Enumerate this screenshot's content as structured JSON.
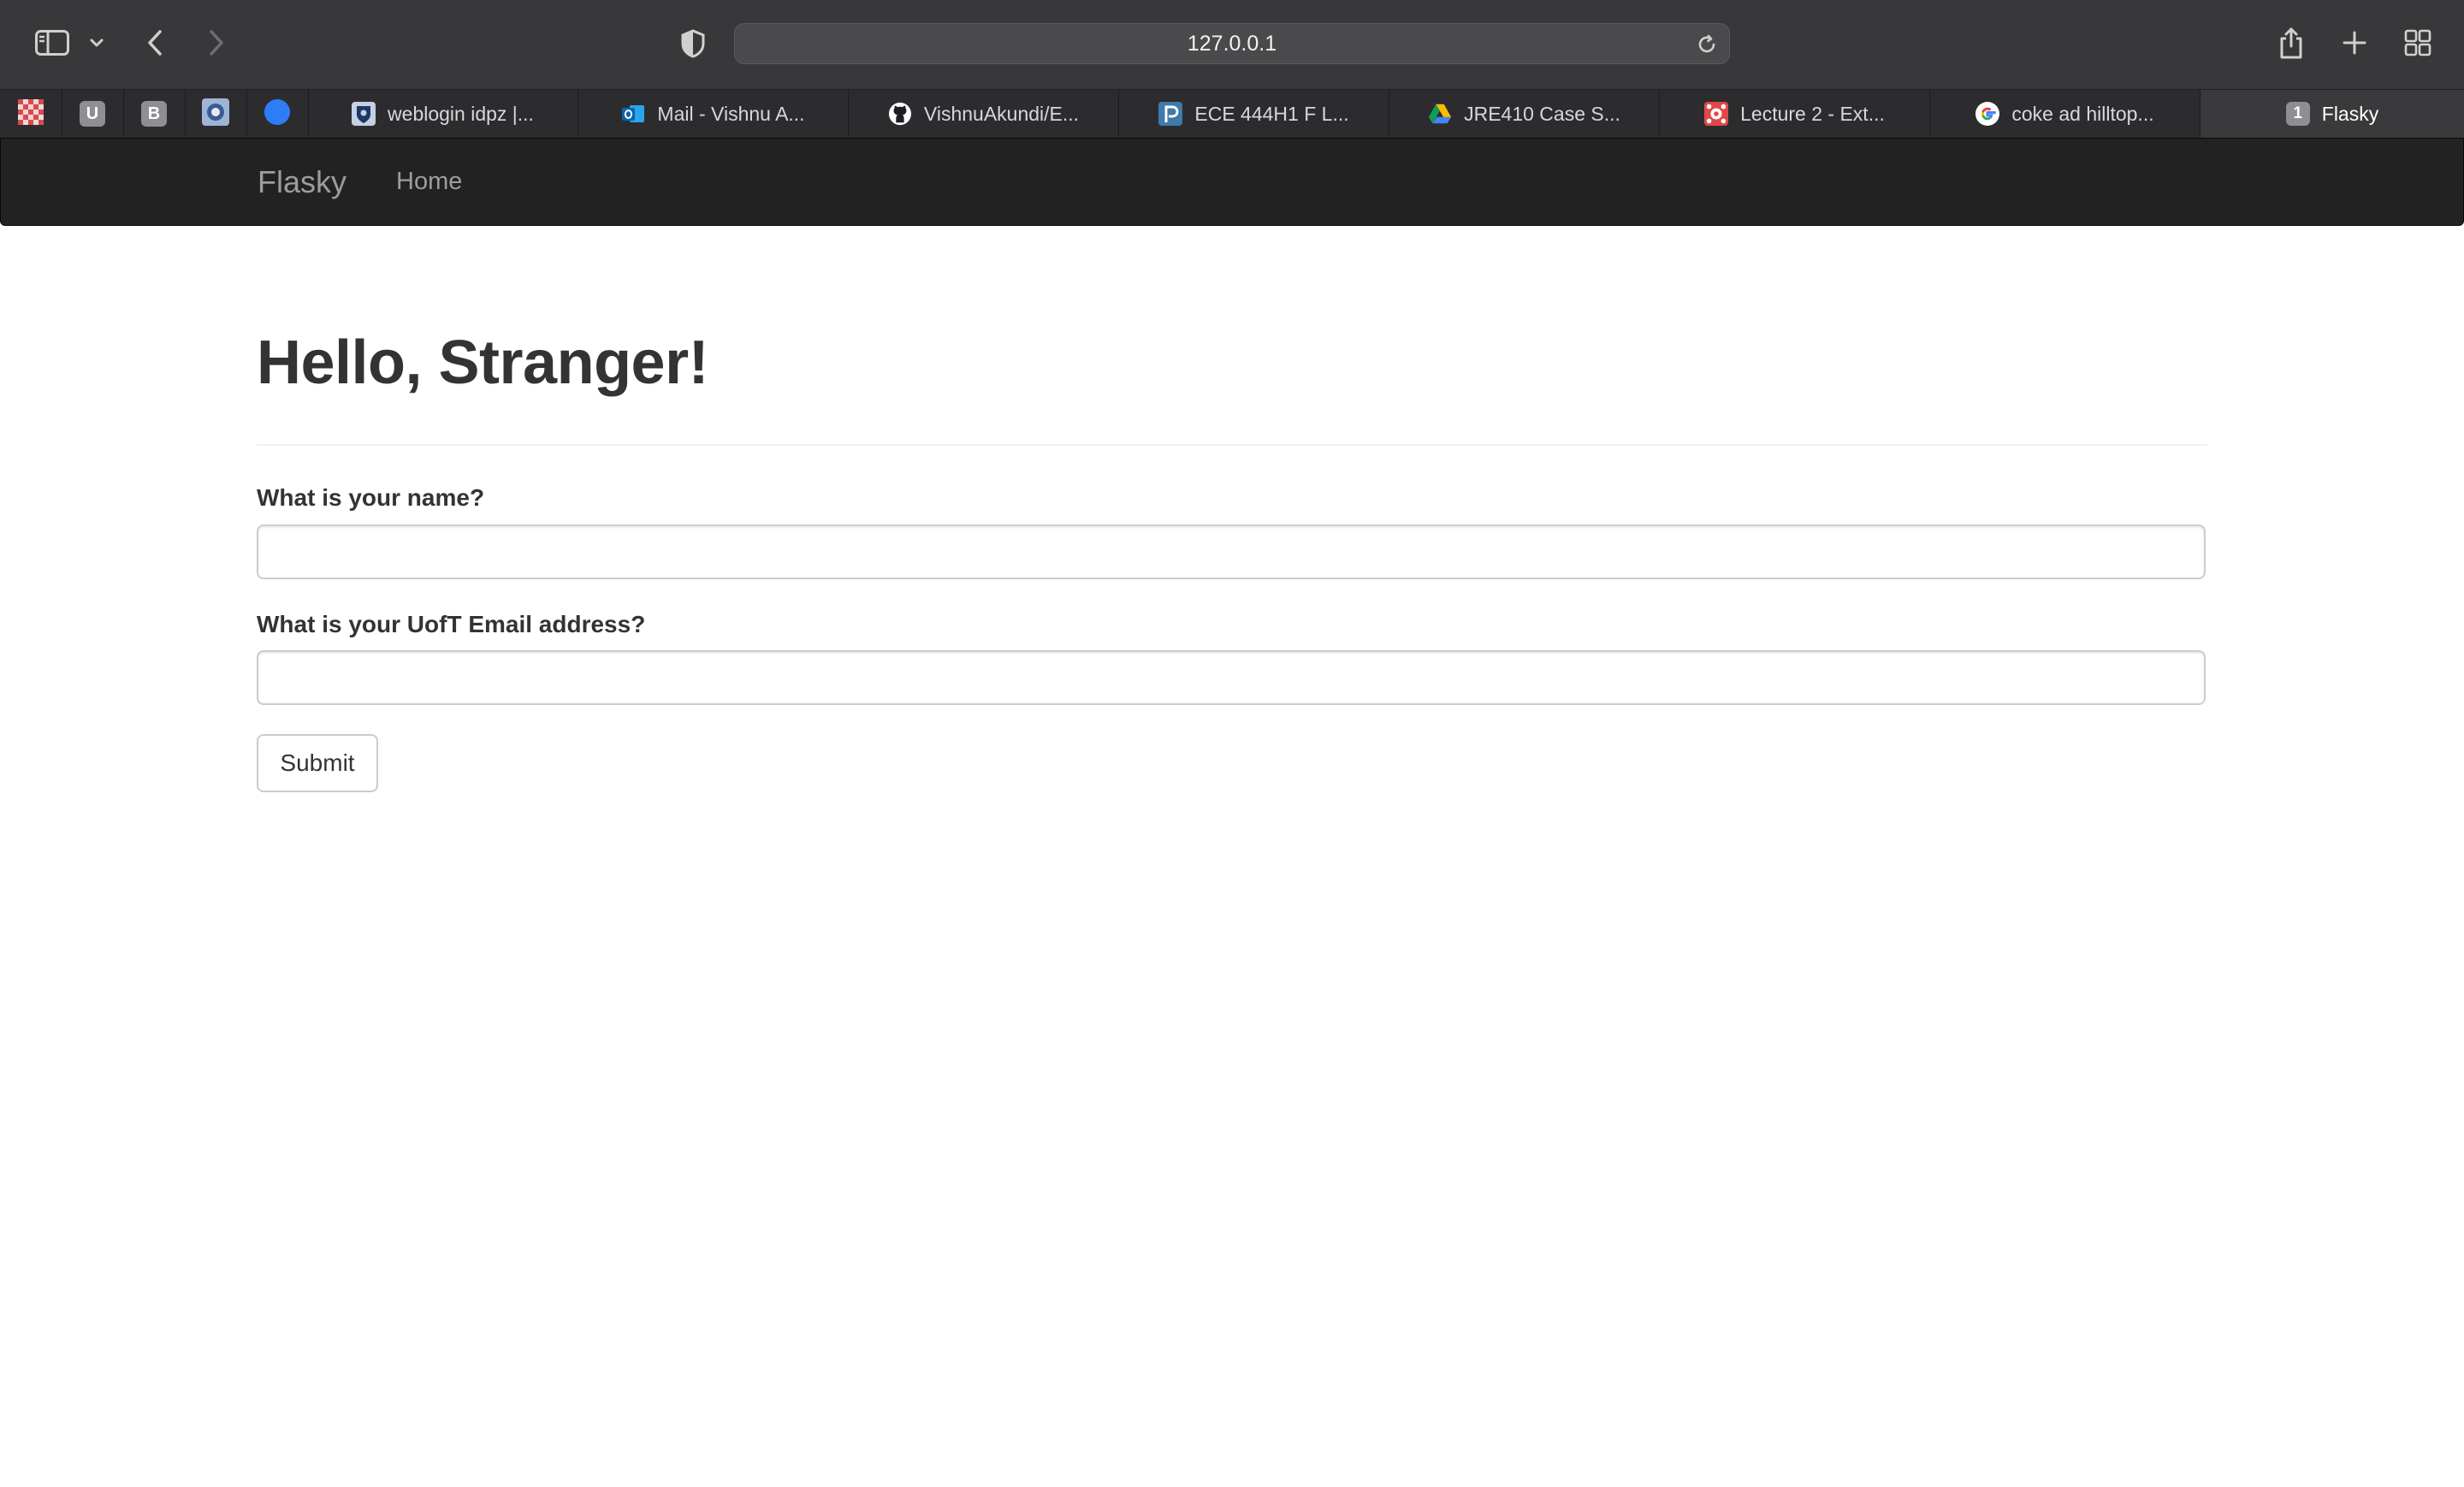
{
  "browser": {
    "url": "127.0.0.1",
    "pinned_tabs": [
      {
        "icon": "checker-red-favicon"
      },
      {
        "icon": "u-favicon",
        "letter": "U"
      },
      {
        "icon": "b-favicon",
        "letter": "B"
      },
      {
        "icon": "crest-favicon"
      },
      {
        "icon": "blue-circle-favicon"
      }
    ],
    "tabs": [
      {
        "label": "weblogin idpz |...",
        "icon": "uoft-crest-favicon"
      },
      {
        "label": "Mail - Vishnu A...",
        "icon": "outlook-favicon"
      },
      {
        "label": "VishnuAkundi/E...",
        "icon": "github-favicon"
      },
      {
        "label": "ECE 444H1 F L...",
        "icon": "piazza-favicon"
      },
      {
        "label": "JRE410 Case S...",
        "icon": "google-drive-favicon"
      },
      {
        "label": "Lecture 2 - Ext...",
        "icon": "red-pattern-favicon"
      },
      {
        "label": "coke ad hilltop...",
        "icon": "google-favicon"
      },
      {
        "label": "Flasky",
        "icon": "number-badge",
        "badge": "1",
        "active": true
      }
    ]
  },
  "navbar": {
    "brand": "Flasky",
    "links": [
      "Home"
    ]
  },
  "page": {
    "heading": "Hello, Stranger!",
    "form": {
      "name_label": "What is your name?",
      "name_value": "",
      "email_label": "What is your UofT Email address?",
      "email_value": "",
      "submit_label": "Submit"
    }
  },
  "colors": {
    "navbar_bg": "#222222",
    "nav_text": "#9d9d9d",
    "heading_text": "#333333"
  }
}
